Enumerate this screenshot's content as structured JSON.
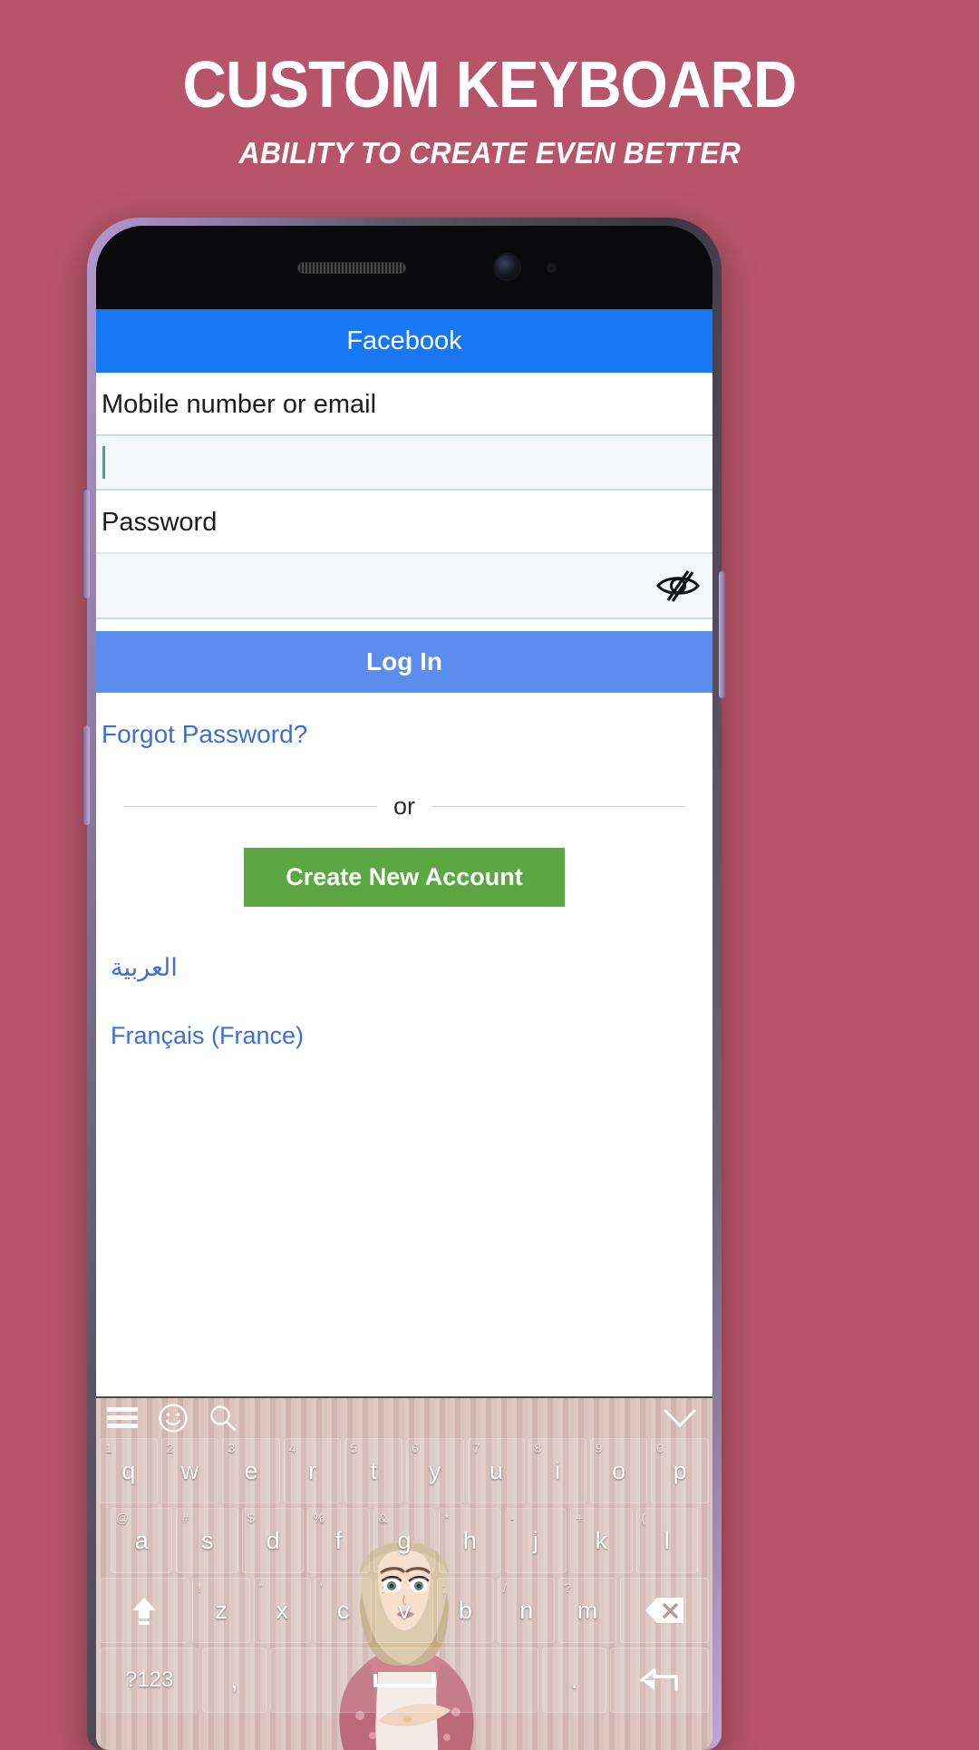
{
  "promo": {
    "title": "CUSTOM KEYBOARD",
    "subtitle": "ABILITY TO CREATE EVEN BETTER",
    "background_color": "#b8546a",
    "text_color": "#ffffff"
  },
  "app": {
    "appbar": {
      "title": "Facebook",
      "color": "#1877f2"
    },
    "email_field": {
      "label": "Mobile number or email",
      "value": "",
      "placeholder": ""
    },
    "password_field": {
      "label": "Password",
      "value": "",
      "placeholder": "",
      "toggle_icon": "eye-off-icon"
    },
    "login_button": {
      "label": "Log In",
      "color": "#5b8def"
    },
    "forgot_link": "Forgot Password?",
    "divider_text": "or",
    "create_button": {
      "label": "Create New Account",
      "color": "#5ba843"
    },
    "languages": [
      {
        "label": "العربية",
        "dir": "rtl"
      },
      {
        "label": "Français (France)",
        "dir": "ltr"
      }
    ],
    "link_color": "#3b6fd4"
  },
  "keyboard": {
    "toolbar": [
      {
        "name": "menu-icon"
      },
      {
        "name": "emoji-icon"
      },
      {
        "name": "search-icon"
      },
      {
        "name": "chevron-down-icon"
      }
    ],
    "rows": [
      [
        {
          "main": "q",
          "hint": "1"
        },
        {
          "main": "w",
          "hint": "2"
        },
        {
          "main": "e",
          "hint": "3"
        },
        {
          "main": "r",
          "hint": "4"
        },
        {
          "main": "t",
          "hint": "5"
        },
        {
          "main": "y",
          "hint": "6"
        },
        {
          "main": "u",
          "hint": "7"
        },
        {
          "main": "i",
          "hint": "8"
        },
        {
          "main": "o",
          "hint": "9"
        },
        {
          "main": "p",
          "hint": "0"
        }
      ],
      [
        {
          "main": "a",
          "hint": "@"
        },
        {
          "main": "s",
          "hint": "#"
        },
        {
          "main": "d",
          "hint": "$"
        },
        {
          "main": "f",
          "hint": "%"
        },
        {
          "main": "g",
          "hint": "&"
        },
        {
          "main": "h",
          "hint": "*"
        },
        {
          "main": "j",
          "hint": "-"
        },
        {
          "main": "k",
          "hint": "+"
        },
        {
          "main": "l",
          "hint": "("
        },
        {
          "main": "",
          "hint": ")"
        }
      ],
      [
        {
          "main": "⬆",
          "hint": "",
          "type": "shift"
        },
        {
          "main": "z",
          "hint": "!"
        },
        {
          "main": "x",
          "hint": "\""
        },
        {
          "main": "c",
          "hint": "'"
        },
        {
          "main": "v",
          "hint": ":"
        },
        {
          "main": "b",
          "hint": ";"
        },
        {
          "main": "n",
          "hint": "/"
        },
        {
          "main": "m",
          "hint": "?"
        },
        {
          "main": "⌫",
          "hint": "",
          "type": "backspace"
        }
      ],
      [
        {
          "main": "?123",
          "hint": "",
          "type": "symbols"
        },
        {
          "main": ",",
          "hint": ""
        },
        {
          "main": "",
          "hint": "",
          "type": "space"
        },
        {
          "main": ".",
          "hint": ""
        },
        {
          "main": "⏎",
          "hint": "",
          "type": "enter"
        }
      ]
    ],
    "theme_color": "#d8bfb8",
    "key_text_color": "#ffffff"
  }
}
